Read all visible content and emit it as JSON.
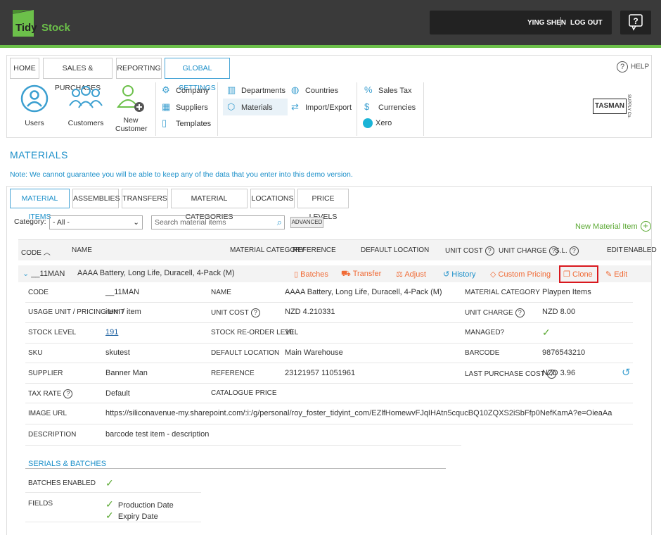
{
  "app": {
    "logo_text_1": "Tidy",
    "logo_text_2": "Stock"
  },
  "user": {
    "name": "YING SHEN",
    "logout": "LOG OUT"
  },
  "top_tabs": [
    "HOME",
    "SALES & PURCHASES",
    "REPORTING",
    "GLOBAL SETTINGS"
  ],
  "help_label": "HELP",
  "settings_menu": {
    "users": "Users",
    "customers": "Customers",
    "new_customer_1": "New",
    "new_customer_2": "Customer",
    "company": "Company",
    "suppliers": "Suppliers",
    "templates": "Templates",
    "departments": "Departments",
    "materials": "Materials",
    "countries": "Countries",
    "import_export": "Import/Export",
    "sales_tax": "Sales Tax",
    "currencies": "Currencies",
    "xero": "Xero"
  },
  "brand": {
    "tasman": "TASMAN",
    "tasman_side": "SUPPLY Co."
  },
  "page": {
    "title": "MATERIALS",
    "note": "Note: We cannot guarantee you will be able to keep any of the data that you enter into this demo version."
  },
  "sub_tabs": [
    "MATERIAL ITEMS",
    "ASSEMBLIES",
    "TRANSFERS",
    "MATERIAL CATEGORIES",
    "LOCATIONS",
    "PRICE LEVELS"
  ],
  "filters": {
    "category_label": "Category:",
    "category_value": "- All -",
    "search_placeholder": "Search material items",
    "advanced": "ADVANCED",
    "new_item": "New Material Item"
  },
  "columns": {
    "code": "CODE",
    "name": "NAME",
    "material_category": "MATERIAL CATEGORY",
    "reference": "REFERENCE",
    "default_location": "DEFAULT LOCATION",
    "unit_cost": "UNIT COST",
    "unit_charge": "UNIT CHARGE",
    "sl": "S.L.",
    "edit": "EDIT",
    "enabled": "ENABLED"
  },
  "row": {
    "code": "__11MAN",
    "name": "AAAA Battery, Long Life, Duracell, 4-Pack (M)",
    "actions": {
      "batches": "Batches",
      "transfer": "Transfer",
      "adjust": "Adjust",
      "history": "History",
      "custom_pricing": "Custom Pricing",
      "clone": "Clone",
      "edit": "Edit"
    }
  },
  "details": {
    "code_label": "CODE",
    "code": "__11MAN",
    "name_label": "NAME",
    "name": "AAAA Battery, Long Life, Duracell, 4-Pack (M)",
    "material_category_label": "MATERIAL CATEGORY",
    "material_category": "Playpen Items",
    "usage_label": "USAGE UNIT / PRICING UNIT",
    "usage": "item / item",
    "unit_cost_label": "UNIT COST",
    "unit_cost": "NZD 4.210331",
    "unit_charge_label": "UNIT CHARGE",
    "unit_charge": "NZD 8.00",
    "stock_level_label": "STOCK LEVEL",
    "stock_level": "191",
    "reorder_label": "STOCK RE-ORDER LEVEL",
    "reorder": "10",
    "managed_label": "MANAGED?",
    "sku_label": "SKU",
    "sku": "skutest",
    "default_location_label": "DEFAULT LOCATION",
    "default_location": "Main Warehouse",
    "barcode_label": "BARCODE",
    "barcode": "9876543210",
    "supplier_label": "SUPPLIER",
    "supplier": "Banner Man",
    "reference_label": "REFERENCE",
    "reference": "23121957 11051961",
    "last_purchase_label": "LAST PURCHASE COST",
    "last_purchase": "NZD 3.96",
    "tax_rate_label": "TAX RATE",
    "tax_rate": "Default",
    "catalogue_label": "CATALOGUE PRICE",
    "image_url_label": "IMAGE URL",
    "image_url": "https://siliconavenue-my.sharepoint.com/:i:/g/personal/roy_foster_tidyint_com/EZlfHomewvFJqIHAtn5cqucBQ10ZQXS2iSbFfp0NefKamA?e=OieaAa",
    "description_label": "DESCRIPTION",
    "description": "barcode test item - description"
  },
  "serials": {
    "title": "SERIALS & BATCHES",
    "batches_enabled_label": "BATCHES ENABLED",
    "fields_label": "FIELDS",
    "field_1": "Production Date",
    "field_2": "Expiry Date"
  },
  "colors": {
    "accent": "#1b8fc9",
    "action": "#f06a35",
    "green": "#5aa832",
    "header": "#3a3a3a"
  }
}
